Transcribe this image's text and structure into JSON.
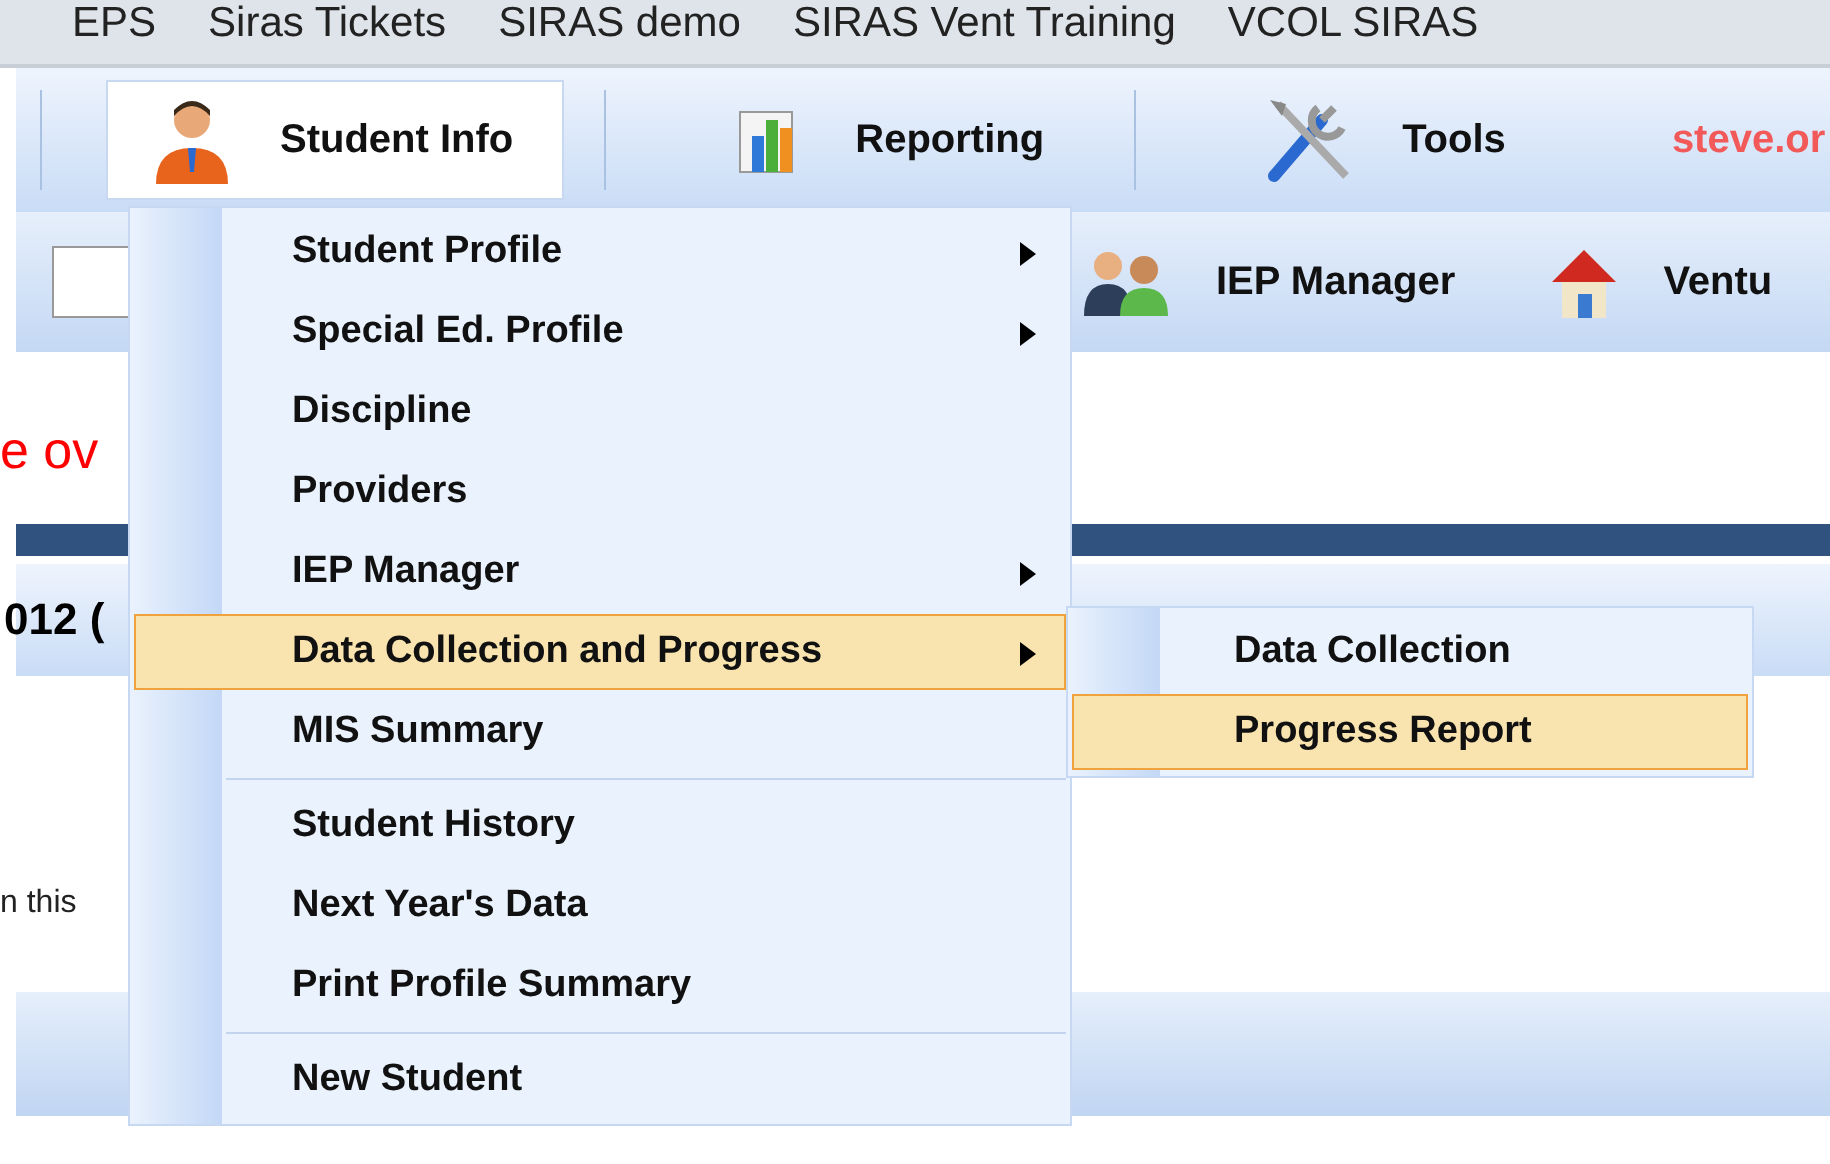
{
  "bookmarks": [
    {
      "label": "EPS"
    },
    {
      "label": "Siras Tickets"
    },
    {
      "label": "SIRAS demo"
    },
    {
      "label": "SIRAS Vent Training"
    },
    {
      "label": "VCOL SIRAS"
    }
  ],
  "main_menu": [
    {
      "label": "Student Info",
      "kind": "person",
      "selected": true
    },
    {
      "label": "Reporting",
      "kind": "chart",
      "selected": false
    },
    {
      "label": "Tools",
      "kind": "tools",
      "selected": false
    }
  ],
  "user_link": "steve.or",
  "toolbar": {
    "items": [
      {
        "label": "IEP Manager",
        "kind": "people"
      },
      {
        "label": "Ventu",
        "kind": "house"
      }
    ]
  },
  "content": {
    "notice": "e ov",
    "section_title": "012 (",
    "body_text": "n this"
  },
  "dropdown": {
    "groups": [
      [
        {
          "label": "Student Profile",
          "has_submenu": true,
          "selected": false
        },
        {
          "label": "Special Ed. Profile",
          "has_submenu": true,
          "selected": false
        },
        {
          "label": "Discipline",
          "has_submenu": false,
          "selected": false
        },
        {
          "label": "Providers",
          "has_submenu": false,
          "selected": false
        },
        {
          "label": "IEP Manager",
          "has_submenu": true,
          "selected": false
        },
        {
          "label": "Data Collection and Progress",
          "has_submenu": true,
          "selected": true
        },
        {
          "label": "MIS Summary",
          "has_submenu": false,
          "selected": false
        }
      ],
      [
        {
          "label": "Student History",
          "has_submenu": false,
          "selected": false
        },
        {
          "label": "Next Year's Data",
          "has_submenu": false,
          "selected": false
        },
        {
          "label": "Print Profile Summary",
          "has_submenu": false,
          "selected": false
        }
      ],
      [
        {
          "label": "New Student",
          "has_submenu": false,
          "selected": false
        }
      ]
    ]
  },
  "submenu": {
    "items": [
      {
        "label": "Data Collection",
        "selected": false
      },
      {
        "label": "Progress Report",
        "selected": true
      }
    ]
  }
}
